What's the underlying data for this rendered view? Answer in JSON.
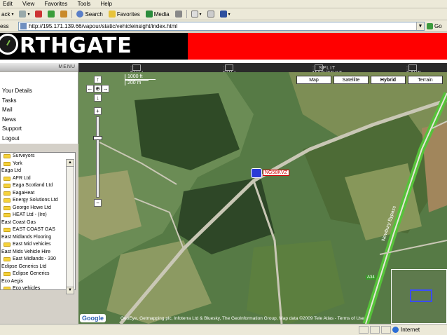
{
  "browser": {
    "menu": [
      "Edit",
      "View",
      "Favorites",
      "Tools",
      "Help"
    ],
    "toolbar": {
      "back": "ack",
      "search": "Search",
      "favorites": "Favorites",
      "media": "Media"
    },
    "address_label": "ess",
    "address": "http://195.171.139.66/vapour/static/vehicleinsight/index.html",
    "go": "Go"
  },
  "header": {
    "logo_text": "NORTHGATE",
    "logo_rest": "RTHGATE"
  },
  "sidebar": {
    "menu_title": "MENU",
    "links": [
      "Your Details",
      "Tasks",
      "Mail",
      "News",
      "Support",
      "Logout"
    ],
    "tree": [
      {
        "text": "Surveyors",
        "folder": true
      },
      {
        "text": "York",
        "folder": true
      },
      {
        "text": "Eaga Ltd",
        "folder": false
      },
      {
        "text": "AFR Ltd",
        "folder": true
      },
      {
        "text": "Eaga Scotland Ltd",
        "folder": true
      },
      {
        "text": "EagaHeat",
        "folder": true
      },
      {
        "text": "Energy Solutions Ltd",
        "folder": true
      },
      {
        "text": "George Howe Ltd",
        "folder": true
      },
      {
        "text": "HEAT Ltd - (Ire)",
        "folder": true
      },
      {
        "text": "East Coast Gas",
        "folder": false
      },
      {
        "text": "EAST COAST GAS",
        "folder": true
      },
      {
        "text": "East Midlands Flooring",
        "folder": false
      },
      {
        "text": "East Mid vehicles",
        "folder": true
      },
      {
        "text": "East Mids Vehicle Hire",
        "folder": false
      },
      {
        "text": "East Midlands - 330",
        "folder": true
      },
      {
        "text": "Eclipse Generics Ltd",
        "folder": false
      },
      {
        "text": "Eclipse Generics",
        "folder": true
      },
      {
        "text": "Eco Aegis",
        "folder": false
      },
      {
        "text": "Eco vehicles",
        "folder": true
      }
    ]
  },
  "map": {
    "tabs": [
      ":: FULL MAP",
      ":: FULL TEXT",
      ":: SPLIT MAP/TEXT",
      ":: SAVE"
    ],
    "types": [
      "Map",
      "Satellite",
      "Hybrid",
      "Terrain"
    ],
    "selected_type": "Hybrid",
    "scale_ft": "1000 ft",
    "scale_m": "200 m",
    "marker_label": "NG58KVZ",
    "road_label_a34": "A34",
    "road_label_bypass": "Newbury Bypass",
    "google": "Google",
    "copyright": "GeoEye, Getmapping plc, Infoterra Ltd & Bluesky, The GeoInformation Group, Map data ©2009 Tele Atlas - Terms of Use"
  },
  "status": {
    "zone": "Internet"
  }
}
